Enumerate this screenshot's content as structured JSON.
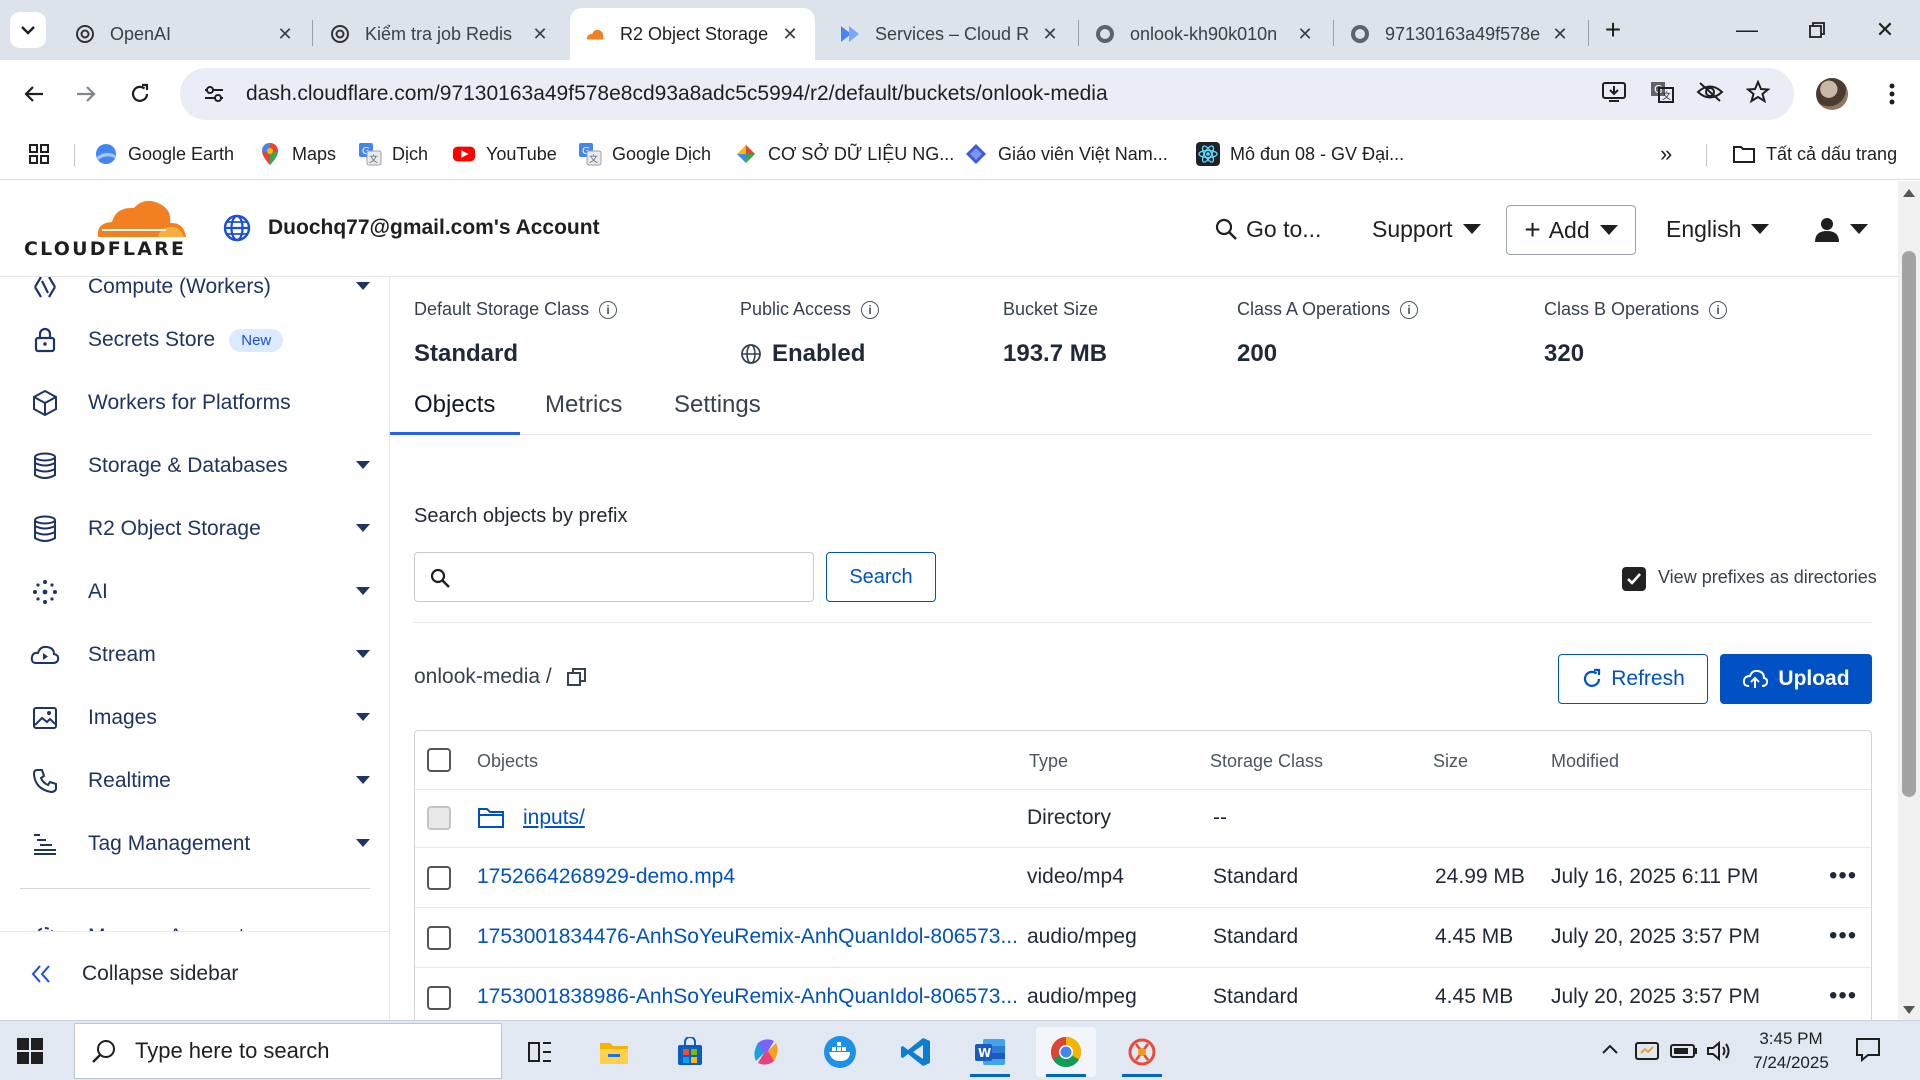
{
  "browser": {
    "tabs": [
      {
        "title": "OpenAI",
        "icon": "openai-icon"
      },
      {
        "title": "Kiểm tra job Redis",
        "icon": "openai-icon"
      },
      {
        "title": "R2 Object Storage",
        "icon": "cloudflare-icon",
        "active": true
      },
      {
        "title": "Services – Cloud R",
        "icon": "cloud-run-icon"
      },
      {
        "title": "onlook-kh90k010n",
        "icon": "globe-icon"
      },
      {
        "title": "97130163a49f578e",
        "icon": "globe-icon"
      }
    ],
    "url": "dash.cloudflare.com/97130163a49f578e8cd93a8adc5c5994/r2/default/buckets/onlook-media",
    "bookmarks": [
      {
        "label": "Google Earth",
        "icon": "google-earth-icon"
      },
      {
        "label": "Maps",
        "icon": "maps-pin-icon"
      },
      {
        "label": "Dịch",
        "icon": "translate-icon"
      },
      {
        "label": "YouTube",
        "icon": "youtube-icon"
      },
      {
        "label": "Google Dịch",
        "icon": "translate-icon"
      },
      {
        "label": "CƠ SỞ DỮ LIỆU NG...",
        "icon": "colorful-diamond-icon"
      },
      {
        "label": "Giáo viên Việt Nam...",
        "icon": "blue-diamond-icon"
      },
      {
        "label": "Mô đun 08 - GV Đại...",
        "icon": "react-icon"
      }
    ],
    "bookmarks_overflow": "»",
    "all_bookmarks": "Tất cả dấu trang"
  },
  "header": {
    "logo_text": "CLOUDFLARE",
    "account": "Duochq77@gmail.com's Account",
    "goto": "Go to...",
    "support": "Support",
    "add": "Add",
    "language": "English"
  },
  "sidebar": {
    "items": [
      {
        "label": "Compute (Workers)",
        "icon": "workers-icon",
        "has_caret": true
      },
      {
        "label": "Secrets Store",
        "icon": "lock-icon",
        "badge": "New"
      },
      {
        "label": "Workers for Platforms",
        "icon": "cube-icon"
      },
      {
        "label": "Storage & Databases",
        "icon": "database-icon",
        "has_caret": true
      },
      {
        "label": "R2 Object Storage",
        "icon": "database-icon",
        "has_caret": true
      },
      {
        "label": "AI",
        "icon": "ai-sparkle-icon",
        "has_caret": true
      },
      {
        "label": "Stream",
        "icon": "cloud-play-icon",
        "has_caret": true
      },
      {
        "label": "Images",
        "icon": "image-icon",
        "has_caret": true
      },
      {
        "label": "Realtime",
        "icon": "phone-icon",
        "has_caret": true
      },
      {
        "label": "Tag Management",
        "icon": "tag-management-icon",
        "has_caret": true
      },
      {
        "label": "Manage Account",
        "icon": "gear-icon",
        "has_caret": true
      }
    ],
    "collapse": "Collapse sidebar"
  },
  "bucket": {
    "stats": [
      {
        "label": "Default Storage Class",
        "value": "Standard",
        "info": true
      },
      {
        "label": "Public Access",
        "value": "Enabled",
        "info": true,
        "globe": true
      },
      {
        "label": "Bucket Size",
        "value": "193.7 MB"
      },
      {
        "label": "Class A Operations",
        "value": "200",
        "info": true
      },
      {
        "label": "Class B Operations",
        "value": "320",
        "info": true
      }
    ],
    "tabs": [
      "Objects",
      "Metrics",
      "Settings"
    ],
    "active_tab": "Objects",
    "search_label": "Search objects by prefix",
    "search_value": "",
    "search_button": "Search",
    "view_prefixes": "View prefixes as directories",
    "view_prefixes_checked": true,
    "breadcrumb": "onlook-media /",
    "refresh": "Refresh",
    "upload": "Upload",
    "columns": [
      "Objects",
      "Type",
      "Storage Class",
      "Size",
      "Modified"
    ],
    "rows": [
      {
        "name": "inputs/",
        "type": "Directory",
        "storage": "--",
        "size": "",
        "modified": "",
        "directory": true
      },
      {
        "name": "1752664268929-demo.mp4",
        "type": "video/mp4",
        "storage": "Standard",
        "size": "24.99 MB",
        "modified": "July 16, 2025 6:11 PM"
      },
      {
        "name": "1753001834476-AnhSoYeuRemix-AnhQuanIdol-806573...",
        "type": "audio/mpeg",
        "storage": "Standard",
        "size": "4.45 MB",
        "modified": "July 20, 2025 3:57 PM"
      },
      {
        "name": "1753001838986-AnhSoYeuRemix-AnhQuanIdol-806573...",
        "type": "audio/mpeg",
        "storage": "Standard",
        "size": "4.45 MB",
        "modified": "July 20, 2025 3:57 PM"
      }
    ],
    "row_menu": "•••"
  },
  "taskbar": {
    "search_placeholder": "Type here to search",
    "time": "3:45 PM",
    "date": "7/24/2025",
    "apps": [
      "task-view-icon",
      "file-explorer-icon",
      "microsoft-store-icon",
      "copilot-icon",
      "docker-icon",
      "vscode-icon",
      "word-icon",
      "chrome-icon",
      "app-icon"
    ]
  },
  "colors": {
    "accent": "#0051c3",
    "cloudflare_orange": "#f38020",
    "sidebar_text": "#1d3563"
  }
}
